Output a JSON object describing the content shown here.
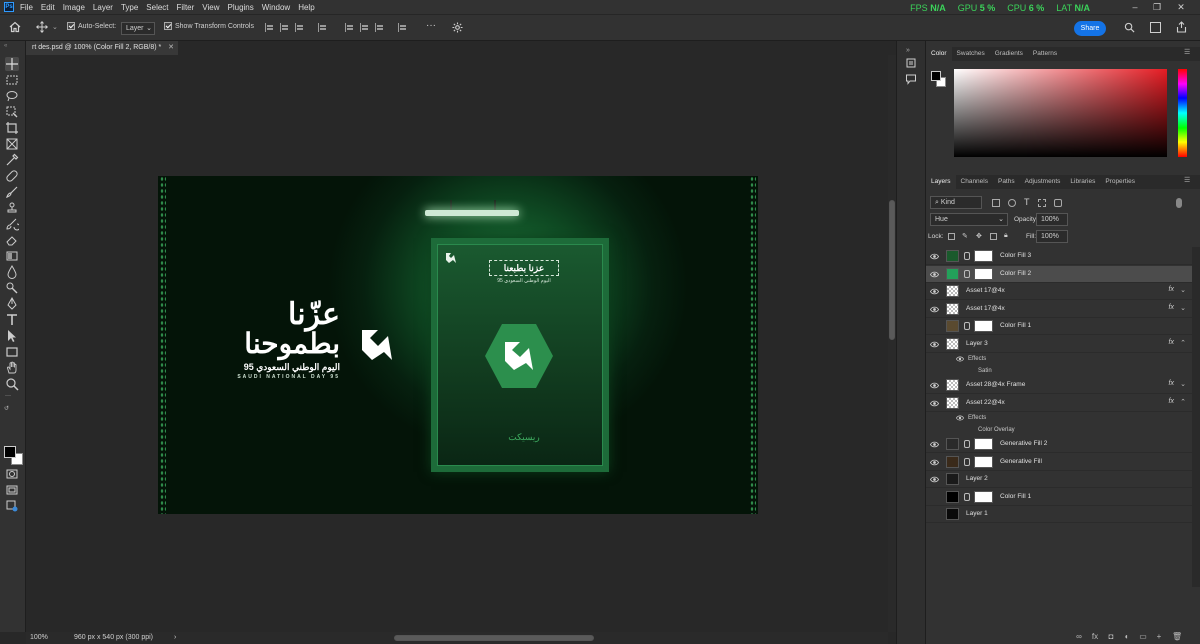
{
  "menubar": {
    "app_logo": "Ps",
    "items": [
      "File",
      "Edit",
      "Image",
      "Layer",
      "Type",
      "Select",
      "Filter",
      "View",
      "Plugins",
      "Window",
      "Help"
    ],
    "stats": [
      {
        "label": "FPS",
        "value": "N/A"
      },
      {
        "label": "GPU",
        "value": "5 %"
      },
      {
        "label": "CPU",
        "value": "6 %"
      },
      {
        "label": "LAT",
        "value": "N/A"
      }
    ]
  },
  "options_bar": {
    "auto_select_label": "Auto-Select:",
    "auto_select_checked": true,
    "auto_select_value": "Layer",
    "show_transform_label": "Show Transform Controls",
    "show_transform_checked": true,
    "more_label": "···",
    "share_label": "Share"
  },
  "document": {
    "tab_title": "rt des.psd @ 100% (Color Fill 2, RGB/8) *",
    "zoom": "100%",
    "doc_info": "960 px x 540 px (300 ppi)"
  },
  "artwork": {
    "headline_line1": "عزّنا",
    "headline_line2": "بطموحنا",
    "subtitle": "اليوم الوطني السعودي 95",
    "english_subtitle": "SAUDI NATIONAL DAY 95",
    "poster_badge": "عزنا بطبعنا",
    "poster_subtitle": "اليوم الوطني السعودي 95",
    "poster_footer": "ريسيكت"
  },
  "color_panel": {
    "tabs": [
      "Color",
      "Swatches",
      "Gradients",
      "Patterns"
    ],
    "active_tab": "Color",
    "foreground_color": "#000000",
    "background_color": "#ffffff"
  },
  "layers_panel": {
    "tabs": [
      "Layers",
      "Channels",
      "Paths",
      "Adjustments",
      "Libraries",
      "Properties"
    ],
    "active_tab": "Layers",
    "filter_kind": "Kind",
    "blend_mode": "Hue",
    "opacity_label": "Opacity:",
    "opacity_value": "100%",
    "lock_label": "Lock:",
    "fill_label": "Fill:",
    "fill_value": "100%",
    "layers": [
      {
        "name": "Color Fill 3",
        "visible": true,
        "thumb": "#1a5a2c",
        "mask": true,
        "fx": false
      },
      {
        "name": "Color Fill 2",
        "visible": true,
        "thumb": "#23a05a",
        "mask": true,
        "fx": false,
        "selected": true
      },
      {
        "name": "Asset 17@4x",
        "visible": true,
        "thumb": "checker",
        "mask": false,
        "fx": true
      },
      {
        "name": "Asset 17@4x",
        "visible": true,
        "thumb": "checker",
        "mask": false,
        "fx": true
      },
      {
        "name": "Color Fill 1",
        "visible": false,
        "thumb": "#5a4a30",
        "mask": true,
        "fx": false
      },
      {
        "name": "Layer 3",
        "visible": true,
        "thumb": "checker",
        "mask": false,
        "fx": true,
        "effects": [
          "Satin"
        ]
      },
      {
        "name": "Asset 28@4x Frame",
        "visible": true,
        "thumb": "checker",
        "mask": false,
        "fx": true
      },
      {
        "name": "Asset 22@4x",
        "visible": true,
        "thumb": "checker",
        "mask": false,
        "fx": true,
        "effects": [
          "Color Overlay"
        ]
      },
      {
        "name": "Generative Fill 2",
        "visible": true,
        "thumb": "#2a2a2a",
        "mask": true,
        "fx": false
      },
      {
        "name": "Generative Fill",
        "visible": true,
        "thumb": "#3a2a1a",
        "mask": true,
        "fx": false
      },
      {
        "name": "Layer 2",
        "visible": true,
        "thumb": "#1a1a1a",
        "mask": false,
        "fx": false
      },
      {
        "name": "Color Fill 1",
        "visible": false,
        "thumb": "#000000",
        "mask": true,
        "fx": false
      },
      {
        "name": "Layer 1",
        "visible": false,
        "thumb": "#0a0a0a",
        "mask": false,
        "fx": false
      }
    ],
    "effects_label": "Effects"
  },
  "colors": {
    "accent": "#1473e6",
    "stat_green": "#3bd35a",
    "artboard_green": "#1f7a3c"
  }
}
